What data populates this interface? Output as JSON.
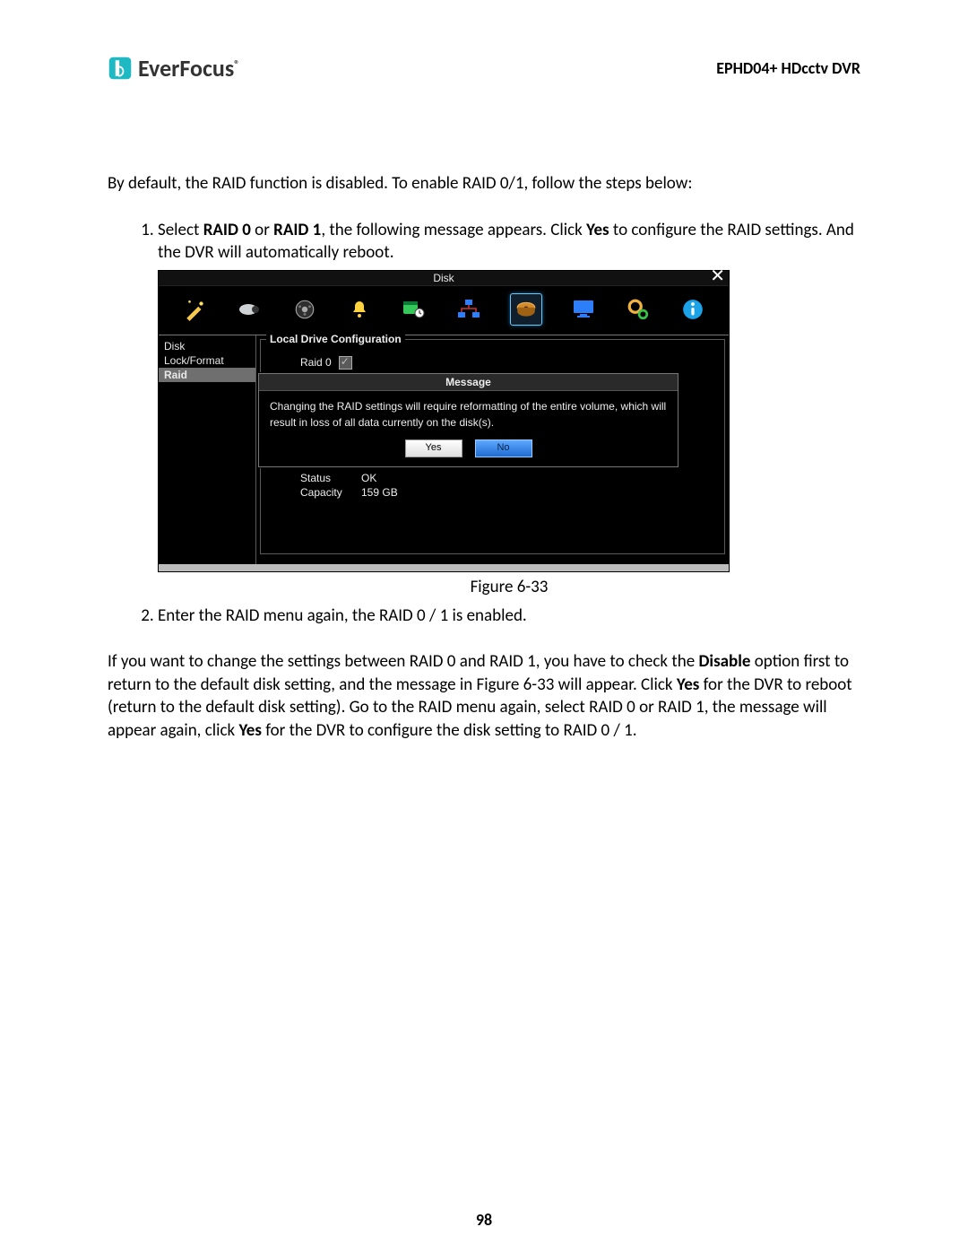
{
  "header": {
    "brand": "EverFocus",
    "product": "EPHD04+  HDcctv DVR"
  },
  "intro": {
    "text_before": "By default, the RAID function is disabled. To enable RAID 0/1, follow the steps below:"
  },
  "steps": {
    "s1_prefix": "Select ",
    "s1_bold1": "RAID 0",
    "s1_mid1": " or ",
    "s1_bold2": "RAID 1",
    "s1_mid2": ", the following message appears. Click ",
    "s1_bold3": "Yes",
    "s1_suffix": " to configure the RAID settings. And the DVR will automatically reboot.",
    "figure_caption": "Figure 6-33",
    "s2": "Enter the RAID menu again, the RAID 0 / 1 is enabled."
  },
  "dvr": {
    "title": "Disk",
    "sidebar": [
      "Disk",
      "Lock/Format",
      "Raid"
    ],
    "main": {
      "legend": "Local Drive Configuration",
      "raid_label": "Raid 0",
      "status_label": "Status",
      "status_value": "OK",
      "capacity_label": "Capacity",
      "capacity_value": "159 GB"
    },
    "message": {
      "title": "Message",
      "body": "Changing the RAID settings will require reformatting of the entire volume, which will result in loss of all data currently on the disk(s).",
      "yes": "Yes",
      "no": "No"
    }
  },
  "paragraph": {
    "p1": "If you want to change the settings between RAID 0 and RAID 1, you have to check the ",
    "p1_b1": "Disable",
    "p2": " option first to return to the default disk setting, and the message in Figure 6-33 will appear. Click ",
    "p2_b1": "Yes",
    "p3": " for the DVR to reboot (return to the default disk setting). Go to the RAID menu again, select RAID 0 or RAID 1, the message will appear again, click ",
    "p3_b1": "Yes",
    "p4": " for the DVR to configure the disk setting to RAID 0 / 1."
  },
  "page_number": "98"
}
